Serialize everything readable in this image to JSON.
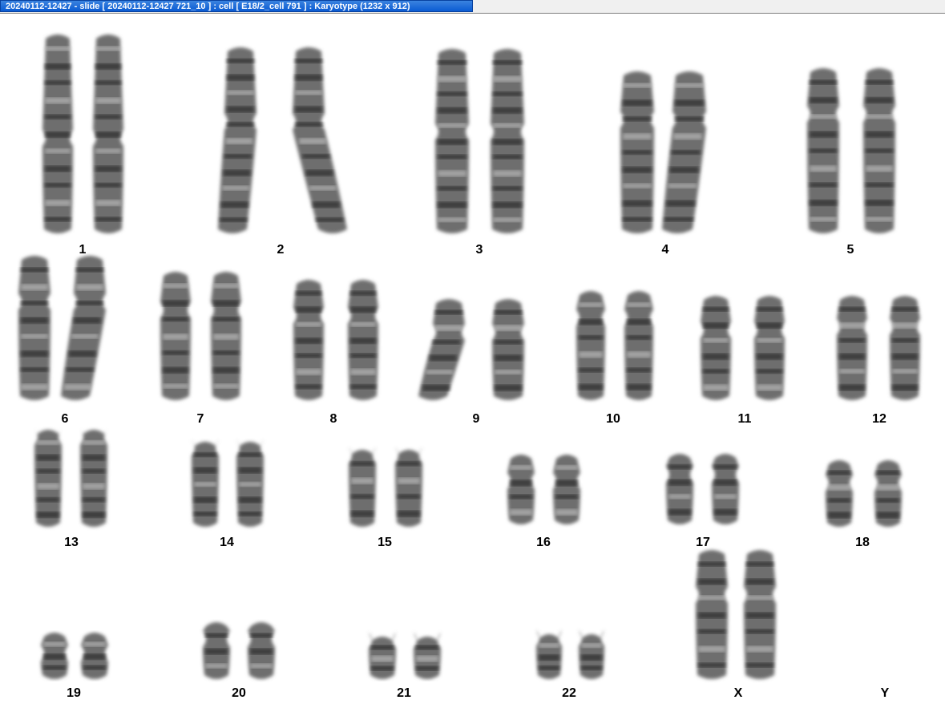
{
  "window": {
    "title": "20240112-12427 - slide [ 20240112-12427 721_10 ] : cell [ E18/2_cell 791 ] : Karyotype  (1232 x 912)"
  },
  "karyotype": {
    "labels": [
      "1",
      "2",
      "3",
      "4",
      "5",
      "6",
      "7",
      "8",
      "9",
      "10",
      "11",
      "12",
      "13",
      "14",
      "15",
      "16",
      "17",
      "18",
      "19",
      "20",
      "21",
      "22",
      "X",
      "Y"
    ]
  },
  "colors": {
    "chromosome_fill": "#6e6e6e",
    "band_dark": "#222222",
    "band_light": "#cfcfcf",
    "title_bar": "#0a5bd3"
  }
}
